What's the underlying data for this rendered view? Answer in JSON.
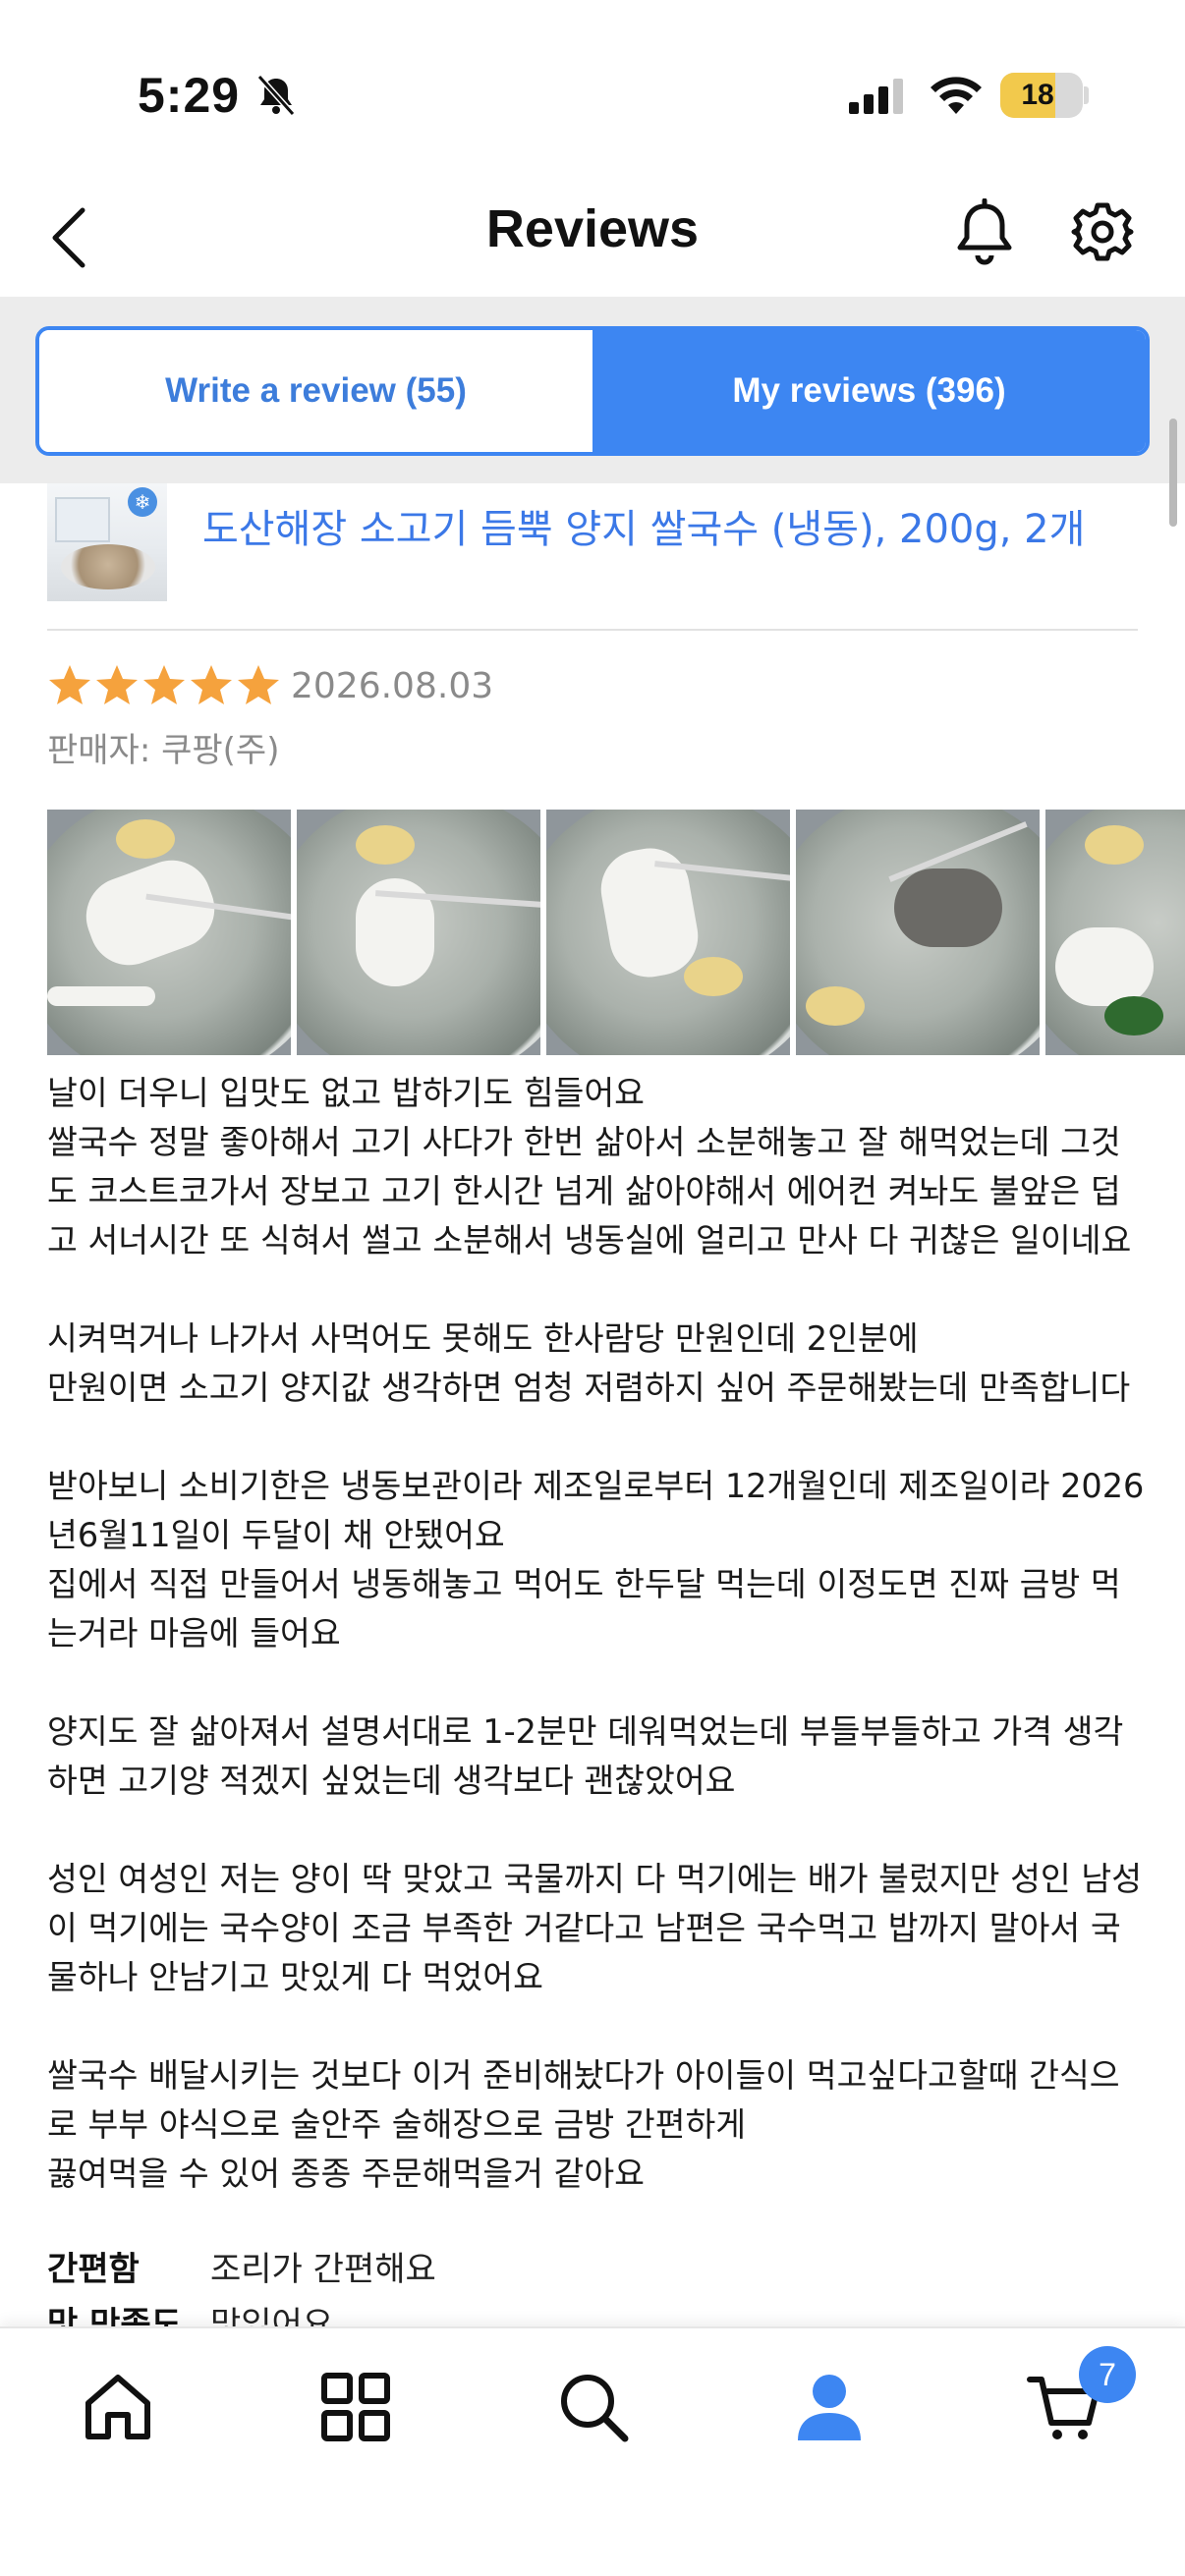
{
  "status_bar": {
    "time": "5:29",
    "battery": "18",
    "battery_level_percent": 18
  },
  "header": {
    "title": "Reviews"
  },
  "tabs": {
    "write_label": "Write a review (55)",
    "my_label": "My reviews (396)",
    "active": "my"
  },
  "product": {
    "name": "도산해장 소고기 듬뿍 양지 쌀국수 (냉동), 200g, 2개"
  },
  "review": {
    "rating": 5,
    "rating_max": 5,
    "date": "2026.08.03",
    "seller": "판매자: 쿠팡(주)",
    "photo_count_visible": 5,
    "paragraphs": [
      "날이 더우니 입맛도 없고 밥하기도 힘들어요\n쌀국수 정말 좋아해서 고기 사다가 한번 삶아서 소분해놓고 잘 해먹었는데 그것도 코스트코가서 장보고 고기 한시간 넘게 삶아야해서 에어컨 켜놔도 불앞은 덥고 서너시간 또 식혀서 썰고 소분해서 냉동실에 얼리고 만사 다 귀찮은 일이네요",
      "시켜먹거나 나가서 사먹어도 못해도 한사람당 만원인데 2인분에\n만원이면 소고기 양지값 생각하면 엄청 저렴하지 싶어 주문해봤는데 만족합니다",
      "받아보니 소비기한은 냉동보관이라 제조일로부터 12개월인데 제조일이라 2026년6월11일이 두달이 채 안됐어요\n집에서 직접 만들어서 냉동해놓고 먹어도 한두달 먹는데 이정도면 진짜 금방 먹는거라 마음에 들어요",
      "양지도 잘 삶아져서 설명서대로 1-2분만 데워먹었는데 부들부들하고 가격 생각하면 고기양 적겠지 싶었는데 생각보다 괜찮았어요",
      "성인 여성인 저는 양이 딱 맞았고 국물까지 다 먹기에는 배가 불렀지만 성인 남성이 먹기에는 국수양이 조금 부족한 거같다고 남편은 국수먹고 밥까지 말아서 국물하나 안남기고 맛있게 다 먹었어요",
      "쌀국수 배달시키는 것보다 이거 준비해놨다가 아이들이 먹고싶다고할때 간식으로 부부 야식으로 술안주 술해장으로 금방 간편하게\n끓여먹을 수 있어 종종 주문해먹을거 같아요"
    ],
    "attributes": [
      {
        "key": "간편함",
        "value": "조리가 간편해요"
      },
      {
        "key": "맛 만족도",
        "value": "맛있어요"
      }
    ]
  },
  "bottom_nav": {
    "items": [
      "home-icon",
      "categories-icon",
      "search-icon",
      "my-account-icon",
      "cart-icon"
    ],
    "active": "my-account-icon",
    "cart_count": "7"
  },
  "colors": {
    "accent": "#3d86f2",
    "link": "#3b78e7",
    "star": "#f5a23d",
    "muted": "#8a8a8a",
    "tab_bg": "#ececec"
  }
}
